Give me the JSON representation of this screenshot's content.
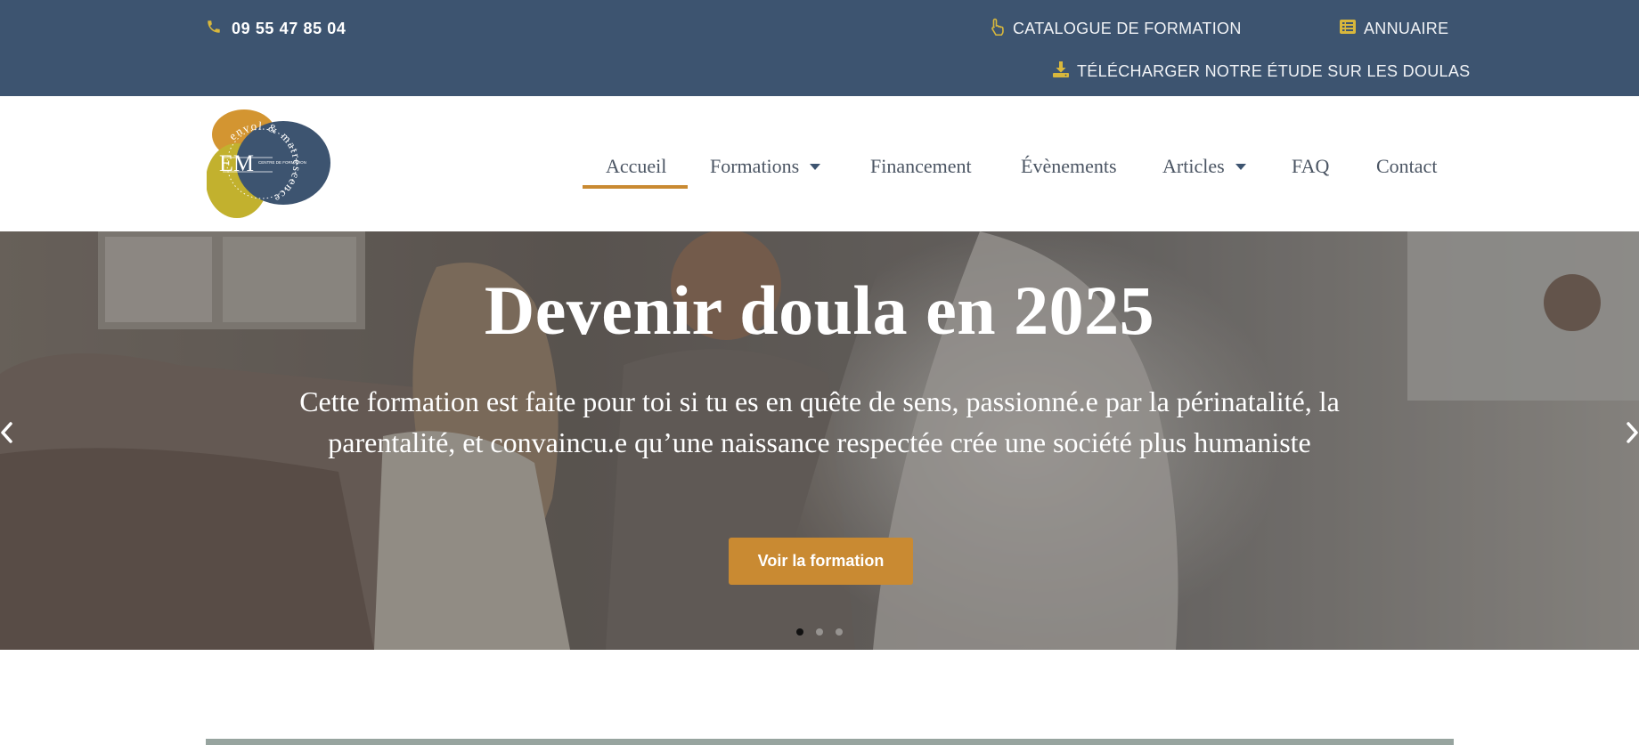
{
  "topbar": {
    "phone": "09 55 47 85 04",
    "catalogue_label": "CATALOGUE DE FORMATION",
    "annuaire_label": "ANNUAIRE",
    "download_label": "TÉLÉCHARGER NOTRE ÉTUDE SUR LES DOULAS",
    "icons": [
      "phone-icon",
      "pointer-hand-icon",
      "list-icon",
      "download-icon"
    ]
  },
  "logo": {
    "initials": "EM",
    "small_text": "CENTRE DE FORMATION",
    "ring_text": "envol & matrescence"
  },
  "nav": {
    "items": [
      {
        "label": "Accueil",
        "active": true
      },
      {
        "label": "Formations",
        "dropdown": true
      },
      {
        "label": "Financement"
      },
      {
        "label": "Évènements"
      },
      {
        "label": "Articles",
        "dropdown": true
      },
      {
        "label": "FAQ"
      },
      {
        "label": "Contact"
      }
    ]
  },
  "hero": {
    "title": "Devenir doula en 2025",
    "subtitle": "Cette formation est faite pour toi si tu es en quête de sens, passionné.e par la périnatalité, la parentalité, et convaincu.e qu’une naissance respectée crée une société plus humaniste",
    "button_label": "Voir la formation",
    "slides_total": 3,
    "active_slide": 1
  },
  "colors": {
    "topbar_bg": "#3d5470",
    "accent": "#c98a32",
    "logo_yellow": "#c2b12e",
    "logo_orange": "#d39531",
    "logo_blue": "#3d5470",
    "divider": "#97a49f"
  }
}
